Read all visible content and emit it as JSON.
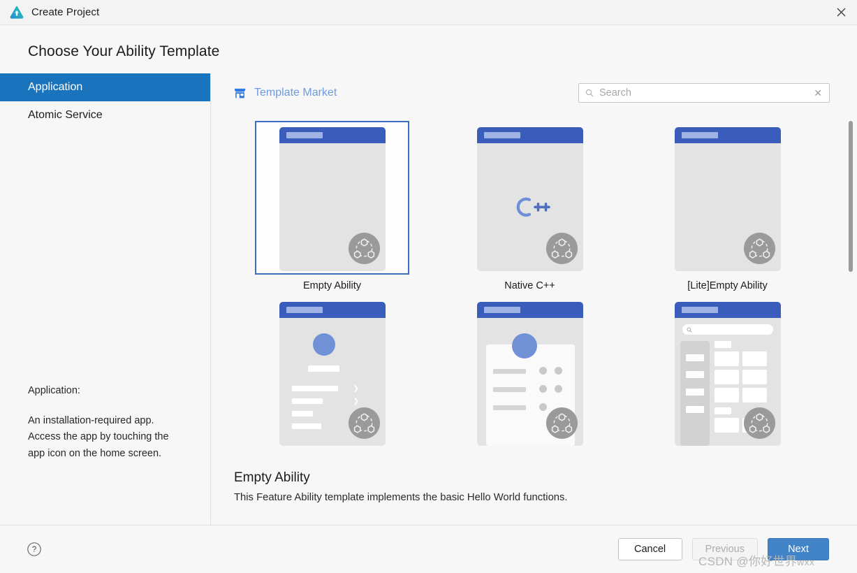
{
  "window": {
    "title": "Create Project",
    "logo_icon": "deveco-studio-logo",
    "close_icon": "close-icon"
  },
  "heading": "Choose Your Ability Template",
  "sidebar": {
    "categories": [
      {
        "label": "Application",
        "selected": true
      },
      {
        "label": "Atomic Service",
        "selected": false
      }
    ],
    "description_title": "Application:",
    "description_body": "An installation-required app. Access the app by touching the app icon on the home screen."
  },
  "toolbar": {
    "market_icon": "store-icon",
    "market_label": "Template Market",
    "search": {
      "icon": "search-icon",
      "placeholder": "Search",
      "value": "",
      "clear_icon": "close-icon",
      "clear_glyph": "✕"
    }
  },
  "templates": [
    {
      "caption": "Empty Ability",
      "art": "empty",
      "selected": true
    },
    {
      "caption": "Native C++",
      "art": "cpp",
      "selected": false
    },
    {
      "caption": "[Lite]Empty Ability",
      "art": "empty",
      "selected": false
    },
    {
      "caption": "",
      "art": "profile",
      "selected": false
    },
    {
      "caption": "",
      "art": "card",
      "selected": false
    },
    {
      "caption": "",
      "art": "grid",
      "selected": false
    }
  ],
  "scrollbar": {
    "name": "templates-scrollbar"
  },
  "detail": {
    "title": "Empty Ability",
    "text": "This Feature Ability template implements the basic Hello World functions."
  },
  "footer": {
    "help_icon": "help-icon",
    "cancel_label": "Cancel",
    "previous_label": "Previous",
    "next_label": "Next"
  },
  "watermark": {
    "prefix": "CSDN @",
    "name": "你好世界",
    "suffix": "wxx"
  },
  "colors": {
    "accent_blue": "#1a73bd",
    "primary_button": "#4284c8",
    "thumb_header": "#3a5dbc",
    "market_link": "#6e9ae0",
    "selected_border": "#3a6fbf"
  }
}
